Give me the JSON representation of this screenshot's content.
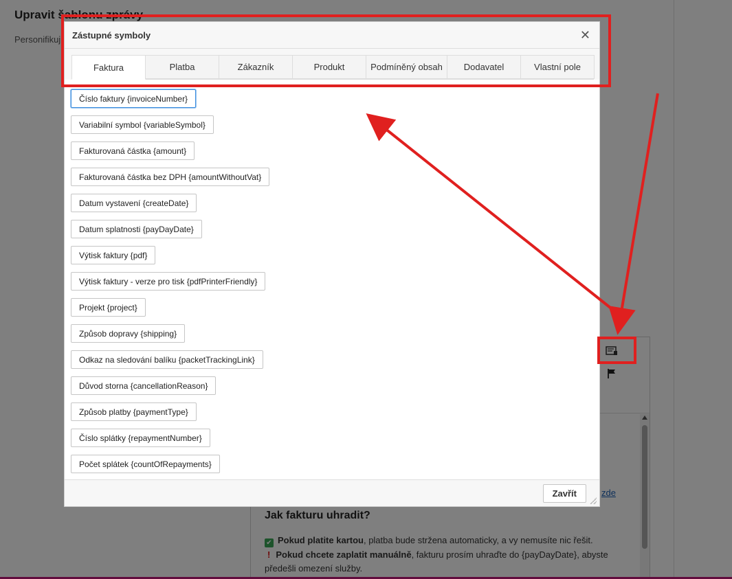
{
  "page": {
    "title": "Upravit šablonu zprávy",
    "subtitle": "Personifikuj"
  },
  "editor": {
    "link_fragment": "zde",
    "heading": "Jak fakturu uhradit?",
    "para1_bold": "Pokud platite kartou",
    "para1_rest": ", platba bude stržena automaticky, a vy nemusíte nic řešit.",
    "para2_bold": "Pokud chcete zaplatit manuálně",
    "para2_rest": ", fakturu prosím uhraďte do {payDayDate}, abyste předešli omezení služby.",
    "toolbar_icons": [
      "insert-placeholder-icon",
      "flag-icon"
    ]
  },
  "dialog": {
    "title": "Zástupné symboly",
    "close_symbol": "✕",
    "tabs": [
      {
        "label": "Faktura",
        "active": true
      },
      {
        "label": "Platba"
      },
      {
        "label": "Zákazník"
      },
      {
        "label": "Produkt"
      },
      {
        "label": "Podmíněný obsah"
      },
      {
        "label": "Dodavatel"
      },
      {
        "label": "Vlastní pole"
      }
    ],
    "symbols": [
      "Číslo faktury {invoiceNumber}",
      "Variabilní symbol {variableSymbol}",
      "Fakturovaná částka {amount}",
      "Fakturovaná částka bez DPH {amountWithoutVat}",
      "Datum vystavení {createDate}",
      "Datum splatnosti {payDayDate}",
      "Výtisk faktury {pdf}",
      "Výtisk faktury - verze pro tisk {pdfPrinterFriendly}",
      "Projekt {project}",
      "Způsob dopravy {shipping}",
      "Odkaz na sledování balíku {packetTrackingLink}",
      "Důvod storna {cancellationReason}",
      "Způsob platby {paymentType}",
      "Číslo splátky {repaymentNumber}",
      "Počet splátek {countOfRepayments}"
    ],
    "footer_close_label": "Zavřít"
  },
  "colors": {
    "annotation": "#e0201f",
    "focus": "#3c8dde",
    "link": "#1a5fb4"
  }
}
